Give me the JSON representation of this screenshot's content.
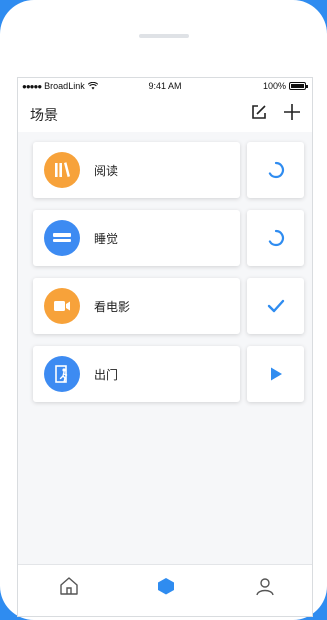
{
  "status_bar": {
    "carrier": "BroadLink",
    "time": "9:41 AM",
    "battery": "100%"
  },
  "nav": {
    "title": "场景",
    "edit_icon": "edit-icon",
    "add_icon": "plus-icon"
  },
  "scenes": [
    {
      "label": "阅读",
      "icon": "book-icon",
      "icon_color": "#f7a23a",
      "action": "loading-spinner"
    },
    {
      "label": "睡觉",
      "icon": "bed-icon",
      "icon_color": "#3d8bf2",
      "action": "loading-spinner"
    },
    {
      "label": "看电影",
      "icon": "video-camera-icon",
      "icon_color": "#f7a23a",
      "action": "checkmark"
    },
    {
      "label": "出门",
      "icon": "exit-door-icon",
      "icon_color": "#3d8bf2",
      "action": "play"
    }
  ],
  "tabs": [
    "home-icon",
    "device-icon",
    "profile-icon"
  ],
  "colors": {
    "accent": "#2f8cf0",
    "orange": "#f7a23a"
  }
}
